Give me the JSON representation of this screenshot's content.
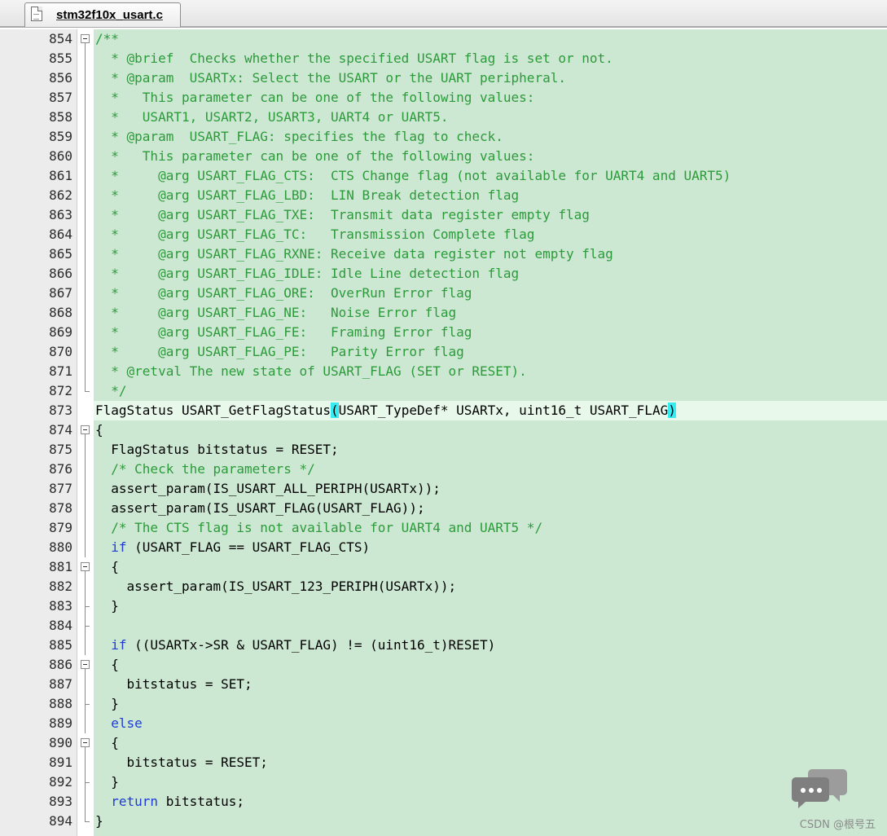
{
  "tab": {
    "label": "stm32f10x_usart.c"
  },
  "editor": {
    "highlighted_line": 873,
    "lines": [
      {
        "n": "854",
        "fold": "open",
        "parts": [
          [
            "c",
            "/**"
          ]
        ]
      },
      {
        "n": "855",
        "fold": "bar",
        "parts": [
          [
            "c",
            "  * @brief  Checks whether the specified USART flag is set or not."
          ]
        ]
      },
      {
        "n": "856",
        "fold": "bar",
        "parts": [
          [
            "c",
            "  * @param  USARTx: Select the USART or the UART peripheral."
          ]
        ]
      },
      {
        "n": "857",
        "fold": "bar",
        "parts": [
          [
            "c",
            "  *   This parameter can be one of the following values:"
          ]
        ]
      },
      {
        "n": "858",
        "fold": "bar",
        "parts": [
          [
            "c",
            "  *   USART1, USART2, USART3, UART4 or UART5."
          ]
        ]
      },
      {
        "n": "859",
        "fold": "bar",
        "parts": [
          [
            "c",
            "  * @param  USART_FLAG: specifies the flag to check."
          ]
        ]
      },
      {
        "n": "860",
        "fold": "bar",
        "parts": [
          [
            "c",
            "  *   This parameter can be one of the following values:"
          ]
        ]
      },
      {
        "n": "861",
        "fold": "bar",
        "parts": [
          [
            "c",
            "  *     @arg USART_FLAG_CTS:  CTS Change flag (not available for UART4 and UART5)"
          ]
        ]
      },
      {
        "n": "862",
        "fold": "bar",
        "parts": [
          [
            "c",
            "  *     @arg USART_FLAG_LBD:  LIN Break detection flag"
          ]
        ]
      },
      {
        "n": "863",
        "fold": "bar",
        "parts": [
          [
            "c",
            "  *     @arg USART_FLAG_TXE:  Transmit data register empty flag"
          ]
        ]
      },
      {
        "n": "864",
        "fold": "bar",
        "parts": [
          [
            "c",
            "  *     @arg USART_FLAG_TC:   Transmission Complete flag"
          ]
        ]
      },
      {
        "n": "865",
        "fold": "bar",
        "parts": [
          [
            "c",
            "  *     @arg USART_FLAG_RXNE: Receive data register not empty flag"
          ]
        ]
      },
      {
        "n": "866",
        "fold": "bar",
        "parts": [
          [
            "c",
            "  *     @arg USART_FLAG_IDLE: Idle Line detection flag"
          ]
        ]
      },
      {
        "n": "867",
        "fold": "bar",
        "parts": [
          [
            "c",
            "  *     @arg USART_FLAG_ORE:  OverRun Error flag"
          ]
        ]
      },
      {
        "n": "868",
        "fold": "bar",
        "parts": [
          [
            "c",
            "  *     @arg USART_FLAG_NE:   Noise Error flag"
          ]
        ]
      },
      {
        "n": "869",
        "fold": "bar",
        "parts": [
          [
            "c",
            "  *     @arg USART_FLAG_FE:   Framing Error flag"
          ]
        ]
      },
      {
        "n": "870",
        "fold": "bar",
        "parts": [
          [
            "c",
            "  *     @arg USART_FLAG_PE:   Parity Error flag"
          ]
        ]
      },
      {
        "n": "871",
        "fold": "bar",
        "parts": [
          [
            "c",
            "  * @retval The new state of USART_FLAG (SET or RESET)."
          ]
        ]
      },
      {
        "n": "872",
        "fold": "end",
        "parts": [
          [
            "c",
            "  */"
          ]
        ]
      },
      {
        "n": "873",
        "fold": "none",
        "parts": [
          [
            "p",
            "FlagStatus USART_GetFlagStatus"
          ],
          [
            "b",
            "("
          ],
          [
            "p",
            "USART_TypeDef* USARTx, uint16_t USART_FLAG"
          ],
          [
            "b",
            ")"
          ]
        ]
      },
      {
        "n": "874",
        "fold": "open",
        "parts": [
          [
            "p",
            "{"
          ]
        ]
      },
      {
        "n": "875",
        "fold": "bar",
        "parts": [
          [
            "p",
            "  FlagStatus bitstatus = RESET;"
          ]
        ]
      },
      {
        "n": "876",
        "fold": "bar",
        "parts": [
          [
            "c",
            "  /* Check the parameters */"
          ]
        ]
      },
      {
        "n": "877",
        "fold": "bar",
        "parts": [
          [
            "p",
            "  assert_param(IS_USART_ALL_PERIPH(USARTx));"
          ]
        ]
      },
      {
        "n": "878",
        "fold": "bar",
        "parts": [
          [
            "p",
            "  assert_param(IS_USART_FLAG(USART_FLAG));"
          ]
        ]
      },
      {
        "n": "879",
        "fold": "bar",
        "parts": [
          [
            "c",
            "  /* The CTS flag is not available for UART4 and UART5 */"
          ]
        ]
      },
      {
        "n": "880",
        "fold": "bar",
        "parts": [
          [
            "k",
            "  if"
          ],
          [
            "p",
            " (USART_FLAG == USART_FLAG_CTS)"
          ]
        ]
      },
      {
        "n": "881",
        "fold": "open",
        "parts": [
          [
            "p",
            "  {"
          ]
        ]
      },
      {
        "n": "882",
        "fold": "bar",
        "parts": [
          [
            "p",
            "    assert_param(IS_USART_123_PERIPH(USARTx));"
          ]
        ]
      },
      {
        "n": "883",
        "fold": "tick",
        "parts": [
          [
            "p",
            "  }"
          ]
        ]
      },
      {
        "n": "884",
        "fold": "tick",
        "parts": [
          [
            "p",
            ""
          ]
        ]
      },
      {
        "n": "885",
        "fold": "bar",
        "parts": [
          [
            "k",
            "  if"
          ],
          [
            "p",
            " ((USARTx->SR & USART_FLAG) != (uint16_t)RESET)"
          ]
        ]
      },
      {
        "n": "886",
        "fold": "open",
        "parts": [
          [
            "p",
            "  {"
          ]
        ]
      },
      {
        "n": "887",
        "fold": "bar",
        "parts": [
          [
            "p",
            "    bitstatus = SET;"
          ]
        ]
      },
      {
        "n": "888",
        "fold": "tick",
        "parts": [
          [
            "p",
            "  }"
          ]
        ]
      },
      {
        "n": "889",
        "fold": "bar",
        "parts": [
          [
            "k",
            "  else"
          ]
        ]
      },
      {
        "n": "890",
        "fold": "open",
        "parts": [
          [
            "p",
            "  {"
          ]
        ]
      },
      {
        "n": "891",
        "fold": "bar",
        "parts": [
          [
            "p",
            "    bitstatus = RESET;"
          ]
        ]
      },
      {
        "n": "892",
        "fold": "tick",
        "parts": [
          [
            "p",
            "  }"
          ]
        ]
      },
      {
        "n": "893",
        "fold": "bar",
        "parts": [
          [
            "k",
            "  return"
          ],
          [
            "p",
            " bitstatus;"
          ]
        ]
      },
      {
        "n": "894",
        "fold": "end",
        "parts": [
          [
            "p",
            "}"
          ]
        ]
      }
    ]
  },
  "watermark": {
    "text": "CSDN @根号五",
    "icon": "chat-bubble-icon"
  }
}
